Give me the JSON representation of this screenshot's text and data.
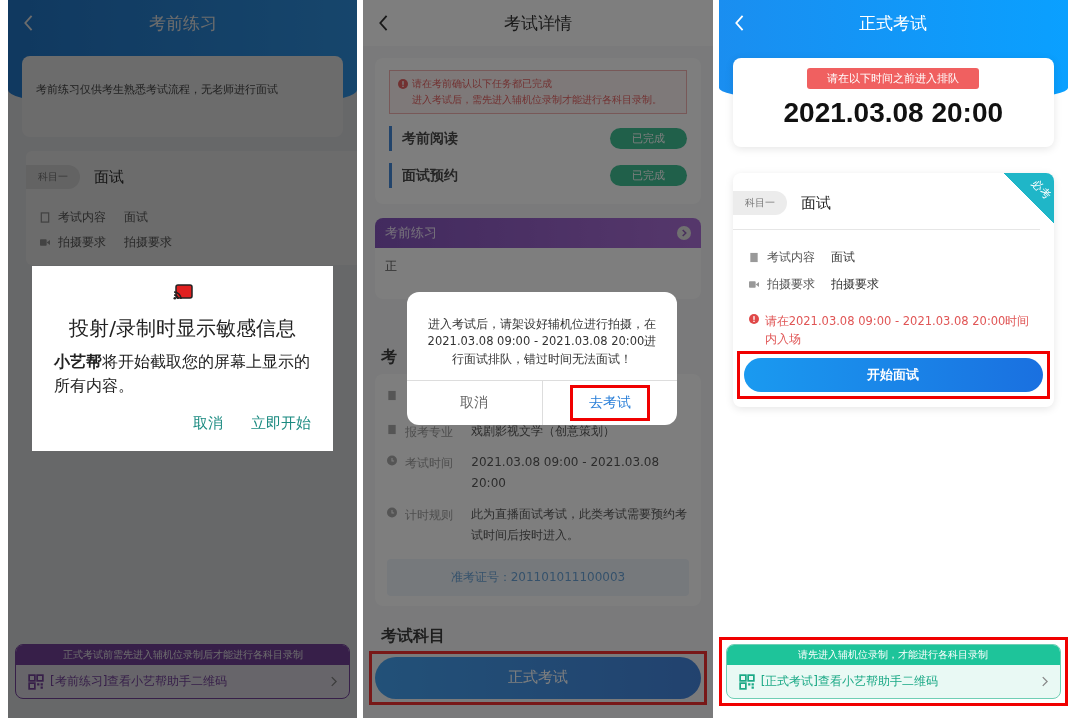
{
  "practice_screen": {
    "title": "考前练习",
    "notice": "考前练习仅供考生熟悉考试流程，无老师进行面试",
    "subject": {
      "tag": "科目一",
      "name": "面试"
    },
    "details": [
      {
        "kind": "doc",
        "label": "考试内容",
        "value": "面试"
      },
      {
        "kind": "video",
        "label": "拍摄要求",
        "value": "拍摄要求"
      }
    ],
    "banner": {
      "header": "正式考试前需先进入辅机位录制后才能进行各科目录制",
      "link": "[考前练习]查看小艺帮助手二维码",
      "highlighted": false
    },
    "dialog": {
      "title": "投射/录制时显示敏感信息",
      "body": "**小艺帮**将开始截取您的屏幕上显示的所有内容。",
      "buttons": [
        "取消",
        "立即开始"
      ]
    }
  },
  "details_screen": {
    "title": "考试详情",
    "alert": [
      "请在考前确认以下任务都已完成",
      "进入考试后，需先进入辅机位录制才能进行各科目录制。"
    ],
    "tasks": [
      {
        "label": "考前阅读",
        "status": "已完成"
      },
      {
        "label": "面试预约",
        "status": "已完成"
      }
    ],
    "practice_card": {
      "title": "考前练习",
      "line": "正"
    },
    "info_heading": "考",
    "info": [
      {
        "kind": "doc",
        "label": "报考专业",
        "value": "戏剧影视文学（创意策划）"
      },
      {
        "kind": "clock",
        "label": "考试时间",
        "value": "2021.03.08 09:00 - 2021.03.08 20:00"
      },
      {
        "kind": "clock",
        "label": "计时规则",
        "value": "此为直播面试考试，此类考试需要预约考试时间后按时进入。"
      }
    ],
    "ticket": "准考证号：201101011100003",
    "subjects_heading": "考试科目",
    "action": {
      "label": "正式考试",
      "highlighted": true
    },
    "dialog": {
      "message": "进入考试后，请架设好辅机位进行拍摄，在2021.03.08 09:00 - 2021.03.08 20:00进行面试排队，错过时间无法面试！",
      "buttons": [
        {
          "label": "取消",
          "highlighted": false
        },
        {
          "label": "去考试",
          "highlighted": true
        }
      ]
    }
  },
  "formal_screen": {
    "title": "正式考试",
    "deadline": {
      "tag": "请在以下时间之前进入排队",
      "time": "2021.03.08 20:00"
    },
    "subject": {
      "ribbon": "必考",
      "tag": "科目一",
      "name": "面试"
    },
    "details": [
      {
        "kind": "doc",
        "label": "考试内容",
        "value": "面试"
      },
      {
        "kind": "video",
        "label": "拍摄要求",
        "value": "拍摄要求"
      }
    ],
    "warning": "请在2021.03.08 09:00 - 2021.03.08 20:00时间内入场",
    "action": {
      "label": "开始面试",
      "highlighted": true
    },
    "banner": {
      "header": "请先进入辅机位录制，才能进行各科目录制",
      "link": "[正式考试]查看小艺帮助手二维码",
      "highlighted": true
    }
  }
}
